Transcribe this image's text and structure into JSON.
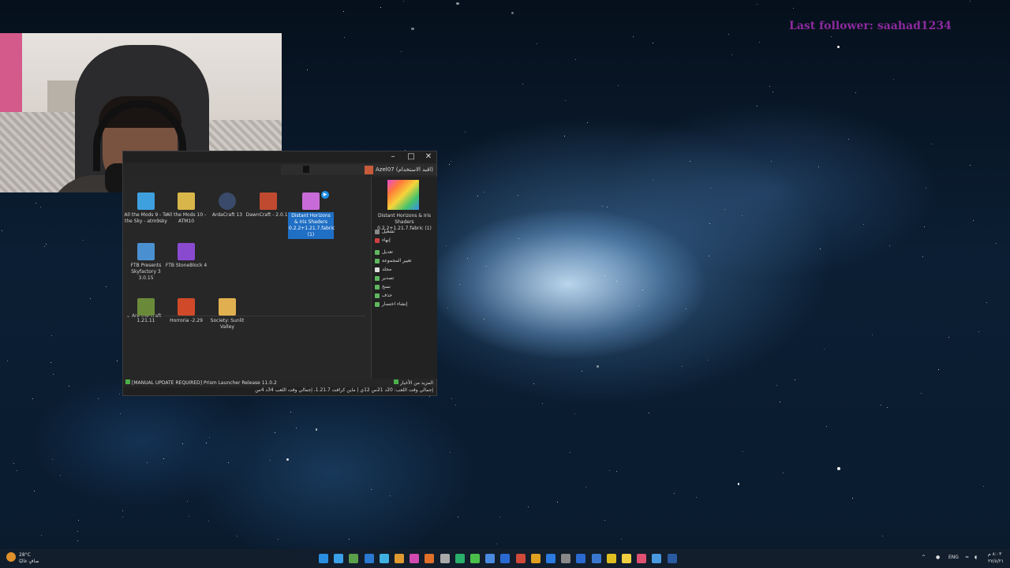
{
  "overlay": {
    "last_follower": "Last follower: saahad1234"
  },
  "launcher": {
    "account_label": "Azel07 (اقبد الاستخدام)",
    "instances": [
      {
        "label": "All the Mods 9 - To the Sky - atm9sky",
        "color": "#3fa0e0"
      },
      {
        "label": "All the Mods 10 - ATM10",
        "color": "#d8b64a"
      },
      {
        "label": "ArdaCraft 13",
        "color": "#3a4a6a"
      },
      {
        "label": "DawnCraft - 2.0.15",
        "color": "#c04a30"
      },
      {
        "label": "Distant Horizons & Iris Shaders 0.2.2+1.21.7.fabric (1)",
        "color": "#c86ad8"
      },
      {
        "label": "FTB Presents Skyfactory 3 3.0.15",
        "color": "#4a90d0"
      },
      {
        "label": "FTB StoneBlock 4",
        "color": "#8a4ad0"
      }
    ],
    "group_name": "Are the craft",
    "group_instances": [
      {
        "label": "1.21.11",
        "color": "#6a8a3a"
      },
      {
        "label": "Horroria -2.29",
        "color": "#d04a2a"
      },
      {
        "label": "Society: Sunlit Valley",
        "color": "#e0b050"
      }
    ],
    "sidebar": {
      "title": "Distant Horizons & Iris Shaders 0.2.2+1.21.7.fabric (1)",
      "actions": [
        "تشغيل",
        "إنهاء",
        "تعديل",
        "تغيير المجموعة",
        "مجلد",
        "تصدير",
        "نسخ",
        "حذف",
        "إنشاء اختصار"
      ]
    },
    "status_update": "[MANUAL UPDATE REQUIRED] Prism Launcher Release 11.0.2",
    "status_news": "المزيد من الأخبار",
    "status_playtime": "إجمالي وقت اللعب: 20د 21س 12ي | ماين كرافت 1.21.7، إجمالي وقت اللعب 34د 4س"
  },
  "taskbar": {
    "weather_temp": "28°C",
    "weather_desc": "صافٍ غالبًا",
    "language": "ENG",
    "time": "٨:٠٣ م",
    "date": "٢٧/٨/٢١",
    "icon_colors": [
      "#2a8ee0",
      "#3aa0e8",
      "#5aa04a",
      "#2a78d0",
      "#3fb0e0",
      "#e09a30",
      "#d04ab0",
      "#e0702a",
      "#aaaaaa",
      "#2ab06a",
      "#4ac04a",
      "#4a8ae0",
      "#2a6ad0",
      "#d04a3a",
      "#e0a020",
      "#2a7ae0",
      "#888888",
      "#2a6ad0",
      "#3a78d0",
      "#e0c020",
      "#f0d040",
      "#e05070",
      "#4a9ae0",
      "#2a5aa0"
    ]
  }
}
